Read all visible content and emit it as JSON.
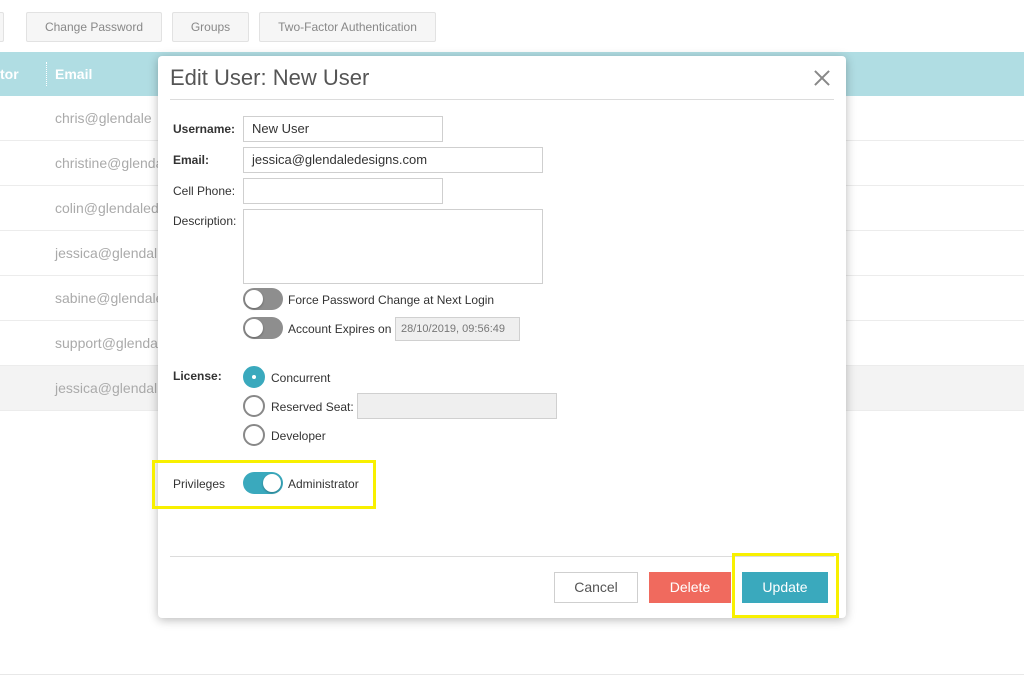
{
  "toolbar": {
    "buttons": [
      "Change Password",
      "Groups",
      "Two-Factor Authentication"
    ]
  },
  "table": {
    "header": {
      "col1": "tor",
      "col2": "Email"
    },
    "rows": [
      "chris@glendale",
      "christine@glenda",
      "colin@glendaled",
      "jessica@glendal",
      "sabine@glendale",
      "support@glenda",
      "jessica@glendal"
    ]
  },
  "modal": {
    "title": "Edit User: New User",
    "fields": {
      "username_label": "Username:",
      "username_value": "New User",
      "email_label": "Email:",
      "email_value": "jessica@glendaledesigns.com",
      "cell_label": "Cell Phone:",
      "cell_value": "",
      "description_label": "Description:",
      "description_value": ""
    },
    "toggles": {
      "force_password": {
        "label": "Force Password Change at Next Login",
        "on": false
      },
      "account_expires": {
        "label": "Account Expires on",
        "on": false,
        "date": "28/10/2019, 09:56:49"
      }
    },
    "license": {
      "label": "License:",
      "options": [
        "Concurrent",
        "Reserved Seat:",
        "Developer"
      ],
      "selected": "Concurrent"
    },
    "privileges": {
      "label": "Privileges",
      "option": "Administrator",
      "on": true
    },
    "buttons": {
      "cancel": "Cancel",
      "delete": "Delete",
      "update": "Update"
    }
  },
  "colors": {
    "accent": "#3aa9bd",
    "danger": "#f06a5e",
    "highlight": "#f8f000",
    "header_bg": "#b0dde3"
  }
}
